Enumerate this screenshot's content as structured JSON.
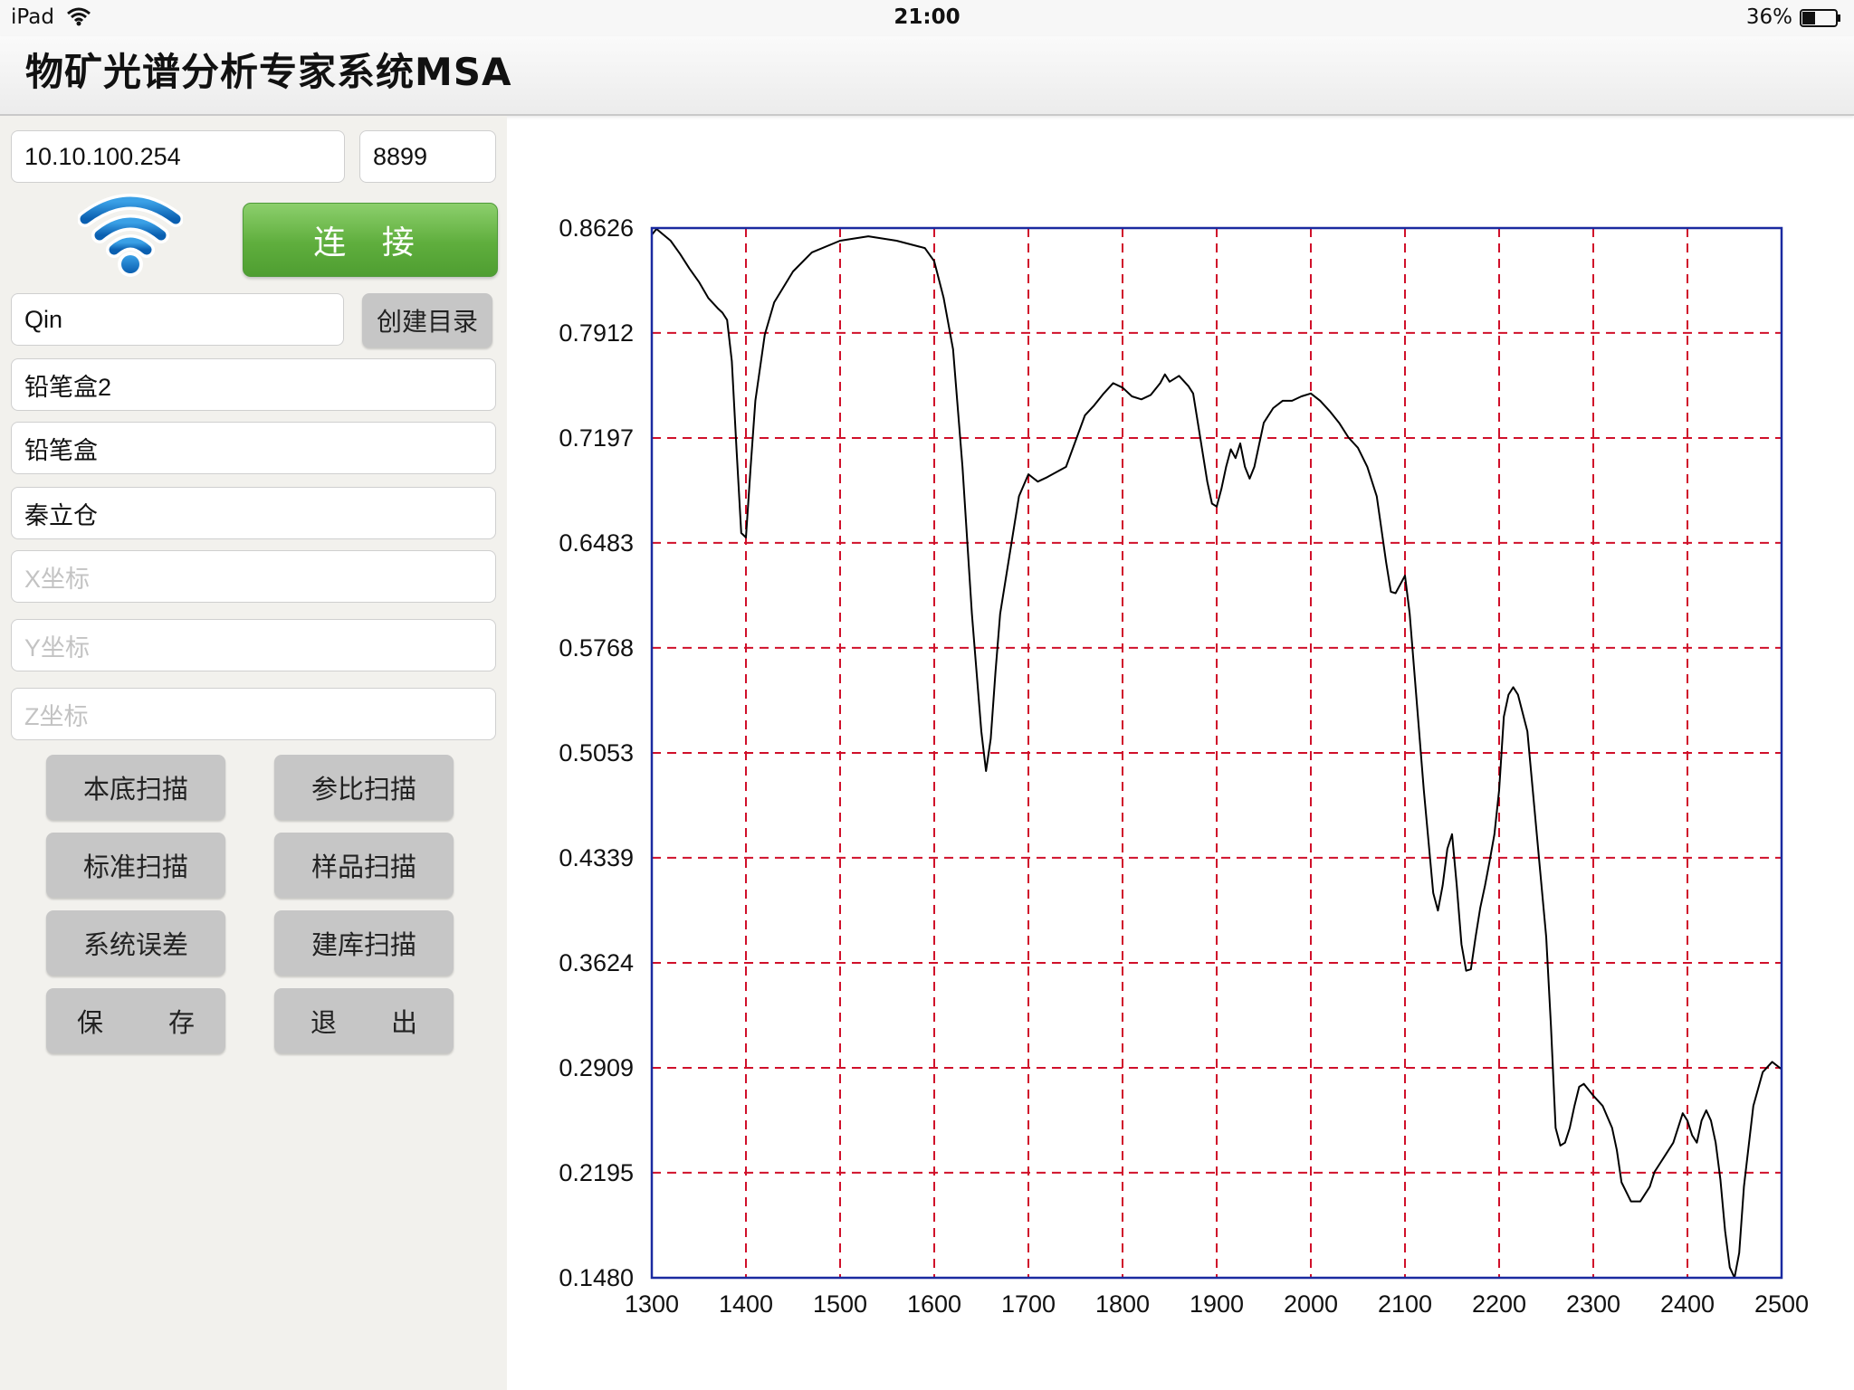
{
  "status_bar": {
    "device": "iPad",
    "time": "21:00",
    "battery": "36%"
  },
  "app": {
    "title": "物矿光谱分析专家系统MSA"
  },
  "connection": {
    "ip": "10.10.100.254",
    "port": "8899",
    "connect_label": "连 接"
  },
  "directory": {
    "name": "Qin",
    "create_label": "创建目录"
  },
  "fields": [
    {
      "value": "铅笔盒2"
    },
    {
      "value": "铅笔盒"
    },
    {
      "value": "秦立仓"
    }
  ],
  "coords": {
    "x_placeholder": "X坐标",
    "y_placeholder": "Y坐标",
    "z_placeholder": "Z坐标"
  },
  "buttons": {
    "background_scan": "本底扫描",
    "reference_scan": "参比扫描",
    "standard_scan": "标准扫描",
    "sample_scan": "样品扫描",
    "system_error": "系统误差",
    "library_scan": "建库扫描",
    "save_left": "保",
    "save_right": "存",
    "exit_left": "退",
    "exit_right": "出"
  },
  "colors": {
    "connect_green": "#5fae3d",
    "grid_red": "#d0102a",
    "plot_frame": "#1a2aa0",
    "curve": "#000000"
  },
  "chart_data": {
    "type": "line",
    "xlim": [
      1300,
      2500
    ],
    "ylim": [
      0.148,
      0.8626
    ],
    "x_ticks": [
      "1300",
      "1400",
      "1500",
      "1600",
      "1700",
      "1800",
      "1900",
      "2000",
      "2100",
      "2200",
      "2300",
      "2400",
      "2500"
    ],
    "y_ticks": [
      "0.8626",
      "0.7912",
      "0.7197",
      "0.6483",
      "0.5768",
      "0.5053",
      "0.4339",
      "0.3624",
      "0.2909",
      "0.2195",
      "0.1480"
    ],
    "grid": true,
    "series": [
      {
        "x": [
          1300,
          1305,
          1320,
          1330,
          1340,
          1350,
          1360,
          1370,
          1375,
          1380,
          1385,
          1390,
          1395,
          1400,
          1405,
          1410,
          1420,
          1430,
          1450,
          1470,
          1500,
          1530,
          1560,
          1590,
          1600,
          1610,
          1620,
          1630,
          1640,
          1650,
          1655,
          1660,
          1665,
          1670,
          1680,
          1690,
          1700,
          1710,
          1720,
          1740,
          1760,
          1770,
          1780,
          1790,
          1800,
          1810,
          1820,
          1830,
          1840,
          1845,
          1850,
          1860,
          1870,
          1875,
          1880,
          1890,
          1895,
          1900,
          1905,
          1910,
          1915,
          1920,
          1925,
          1930,
          1935,
          1940,
          1950,
          1960,
          1970,
          1980,
          1990,
          2000,
          2010,
          2020,
          2030,
          2040,
          2050,
          2060,
          2070,
          2080,
          2085,
          2090,
          2095,
          2100,
          2105,
          2110,
          2120,
          2130,
          2135,
          2140,
          2145,
          2150,
          2155,
          2160,
          2165,
          2170,
          2175,
          2180,
          2185,
          2190,
          2195,
          2200,
          2205,
          2210,
          2215,
          2220,
          2230,
          2240,
          2250,
          2255,
          2260,
          2265,
          2270,
          2275,
          2280,
          2285,
          2290,
          2300,
          2310,
          2320,
          2325,
          2330,
          2340,
          2350,
          2360,
          2365,
          2370,
          2375,
          2380,
          2385,
          2390,
          2395,
          2400,
          2405,
          2410,
          2415,
          2420,
          2425,
          2430,
          2435,
          2440,
          2445,
          2450,
          2455,
          2460,
          2470,
          2480,
          2490,
          2500
        ],
        "values": [
          0.858,
          0.862,
          0.854,
          0.845,
          0.835,
          0.826,
          0.815,
          0.808,
          0.805,
          0.8,
          0.772,
          0.712,
          0.655,
          0.652,
          0.7,
          0.745,
          0.79,
          0.812,
          0.833,
          0.846,
          0.854,
          0.857,
          0.854,
          0.849,
          0.84,
          0.815,
          0.78,
          0.7,
          0.6,
          0.52,
          0.493,
          0.515,
          0.56,
          0.6,
          0.64,
          0.68,
          0.695,
          0.69,
          0.693,
          0.7,
          0.735,
          0.742,
          0.75,
          0.757,
          0.754,
          0.748,
          0.746,
          0.749,
          0.757,
          0.763,
          0.758,
          0.762,
          0.755,
          0.75,
          0.73,
          0.69,
          0.675,
          0.673,
          0.685,
          0.7,
          0.712,
          0.706,
          0.716,
          0.7,
          0.692,
          0.7,
          0.73,
          0.74,
          0.745,
          0.745,
          0.748,
          0.75,
          0.745,
          0.738,
          0.73,
          0.72,
          0.713,
          0.7,
          0.68,
          0.635,
          0.615,
          0.614,
          0.62,
          0.626,
          0.6,
          0.56,
          0.48,
          0.41,
          0.398,
          0.415,
          0.44,
          0.45,
          0.415,
          0.375,
          0.357,
          0.358,
          0.38,
          0.4,
          0.415,
          0.432,
          0.45,
          0.48,
          0.53,
          0.545,
          0.55,
          0.545,
          0.52,
          0.45,
          0.38,
          0.32,
          0.25,
          0.238,
          0.24,
          0.25,
          0.265,
          0.278,
          0.28,
          0.272,
          0.265,
          0.25,
          0.235,
          0.213,
          0.2,
          0.2,
          0.21,
          0.22,
          0.225,
          0.23,
          0.235,
          0.24,
          0.25,
          0.26,
          0.255,
          0.245,
          0.24,
          0.255,
          0.262,
          0.255,
          0.24,
          0.215,
          0.18,
          0.155,
          0.148,
          0.165,
          0.21,
          0.265,
          0.288,
          0.295,
          0.29
        ]
      }
    ]
  }
}
